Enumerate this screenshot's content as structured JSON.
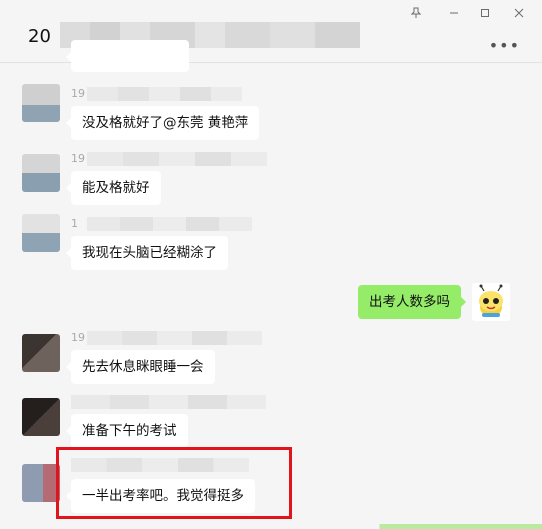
{
  "window": {
    "title_prefix": "20",
    "title_hidden": "",
    "controls": [
      "pin-icon",
      "minimize-icon",
      "maximize-icon",
      "close-icon"
    ],
    "more_label": "•••"
  },
  "messages": [
    {
      "side": "left",
      "name_prefix": "19",
      "text": "没及格就好了@东莞 黄艳萍"
    },
    {
      "side": "left",
      "name_prefix": "19",
      "text": "能及格就好"
    },
    {
      "side": "left",
      "name_prefix": "1",
      "text": "我现在头脑已经糊涂了"
    },
    {
      "side": "right",
      "text": "出考人数多吗"
    },
    {
      "side": "left",
      "name_prefix": "19",
      "text": "先去休息眯眼睡一会"
    },
    {
      "side": "left",
      "name_prefix": "",
      "text": "准备下午的考试"
    },
    {
      "side": "left",
      "name_prefix": "",
      "text": "一半出考率吧。我觉得挺多",
      "highlighted": true
    }
  ],
  "colors": {
    "self_bubble": "#95ec69",
    "other_bubble": "#ffffff",
    "highlight": "#e0141a",
    "background": "#f5f5f5"
  }
}
